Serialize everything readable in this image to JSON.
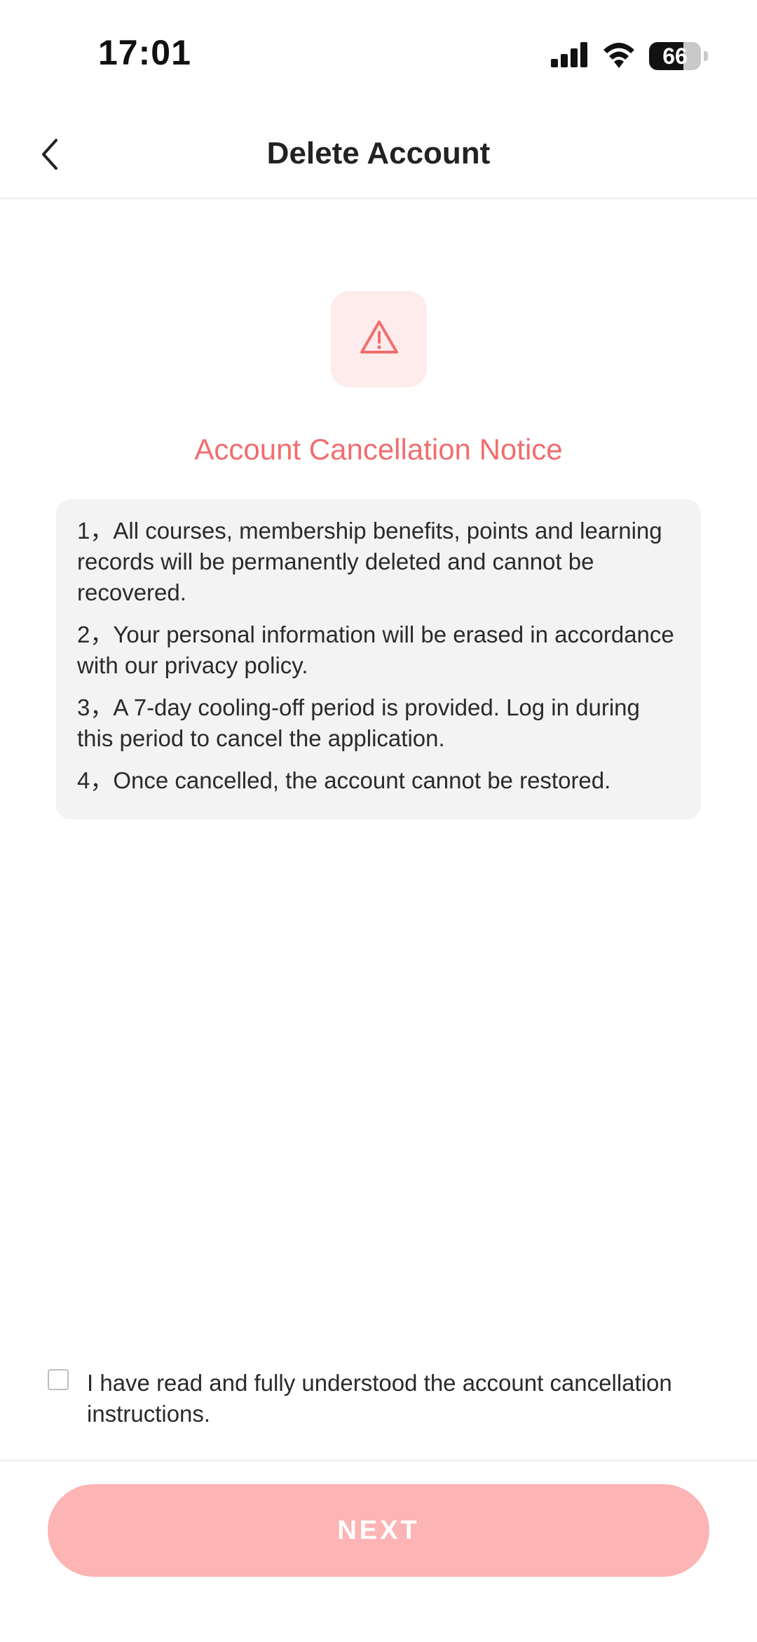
{
  "status_bar": {
    "time": "17:01",
    "battery_level": "66",
    "icons": [
      "signal-icon",
      "wifi-icon",
      "battery-icon"
    ]
  },
  "nav": {
    "title": "Delete Account",
    "back_icon": "chevron-left-icon"
  },
  "notice": {
    "icon": "warning-triangle-icon",
    "title": "Account Cancellation Notice",
    "items": [
      "1，All courses, membership benefits, points and learning records will be permanently deleted and cannot be recovered.",
      "2，Your personal information will be erased in accordance with our privacy policy.",
      "3，A 7-day cooling-off period is provided. Log in during this period to cancel the application.",
      "4，Once cancelled, the account cannot be restored."
    ]
  },
  "agreement": {
    "checked": false,
    "text": "I have read and fully understood the account cancellation instructions."
  },
  "footer": {
    "next_label": "NEXT"
  },
  "colors": {
    "accent": "#f06e6e",
    "icon_bg": "#fdeceb",
    "button_disabled": "#fdb4b4",
    "card_bg": "#f3f3f3"
  }
}
